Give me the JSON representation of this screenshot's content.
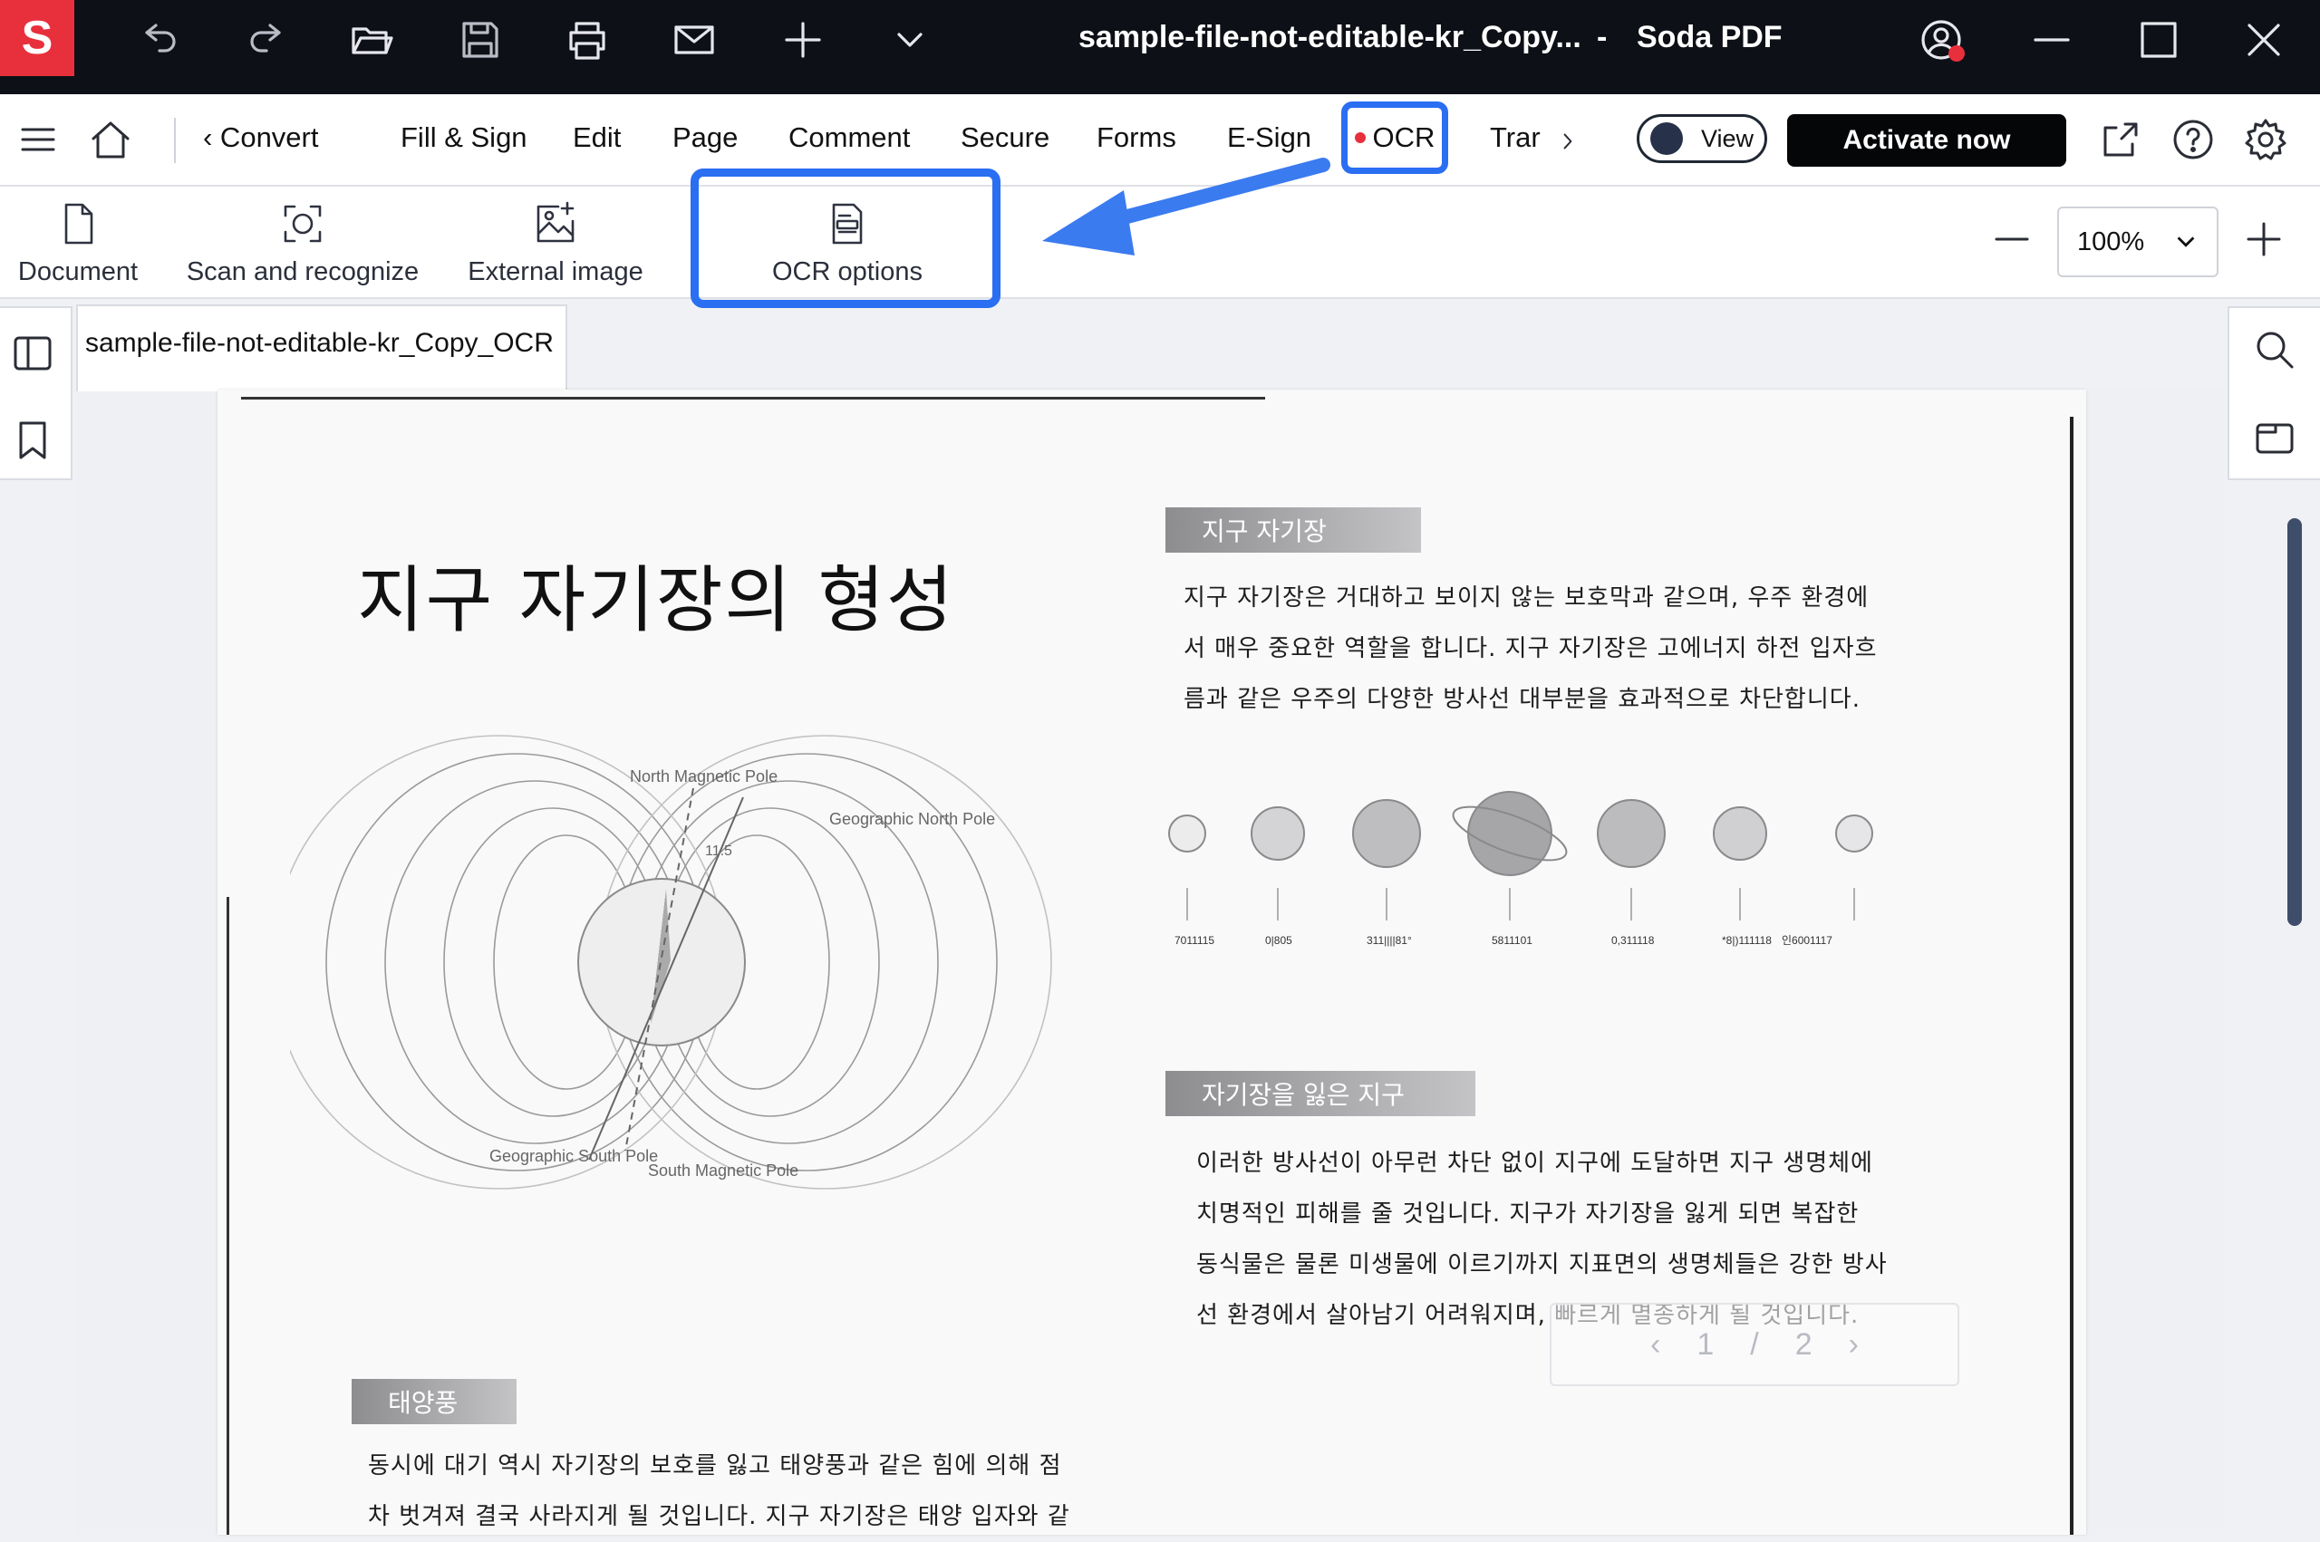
{
  "app": {
    "logo_letter": "S",
    "document_title": "sample-file-not-editable-kr_Copy...",
    "title_separator": "-",
    "app_name": "Soda PDF"
  },
  "titlebar_icons": [
    "undo-icon",
    "redo-icon",
    "open-folder-icon",
    "save-icon",
    "print-icon",
    "mail-icon",
    "plus-icon",
    "chevron-down-icon"
  ],
  "menu": {
    "tabs": [
      "‹ Convert",
      "Fill & Sign",
      "Edit",
      "Page",
      "Comment",
      "Secure",
      "Forms",
      "E-Sign",
      "OCR",
      "Trar"
    ],
    "active_tab": "OCR",
    "view_label": "View",
    "activate_label": "Activate now"
  },
  "ribbon": {
    "items": [
      "Document",
      "Scan and recognize",
      "External image",
      "OCR options"
    ],
    "zoom": "100%"
  },
  "doc_tab": {
    "label": "sample-file-not-editable-kr_Copy_OCR"
  },
  "page": {
    "heading": "지구 자기장의 형성",
    "section1": {
      "label": "지구 자기장",
      "lines": [
        "지구 자기장은 거대하고 보이지 않는 보호막과 같으며, 우주 환경에",
        "서 매우 중요한 역할을 합니다. 지구 자기장은 고에너지 하전 입자흐",
        "름과 같은 우주의 다양한 방사선 대부분을 효과적으로 차단합니다."
      ]
    },
    "planet_labels": [
      "7011115",
      "0|805",
      "311||||81°",
      "5811101",
      "0,311118",
      "*8|)111118",
      "인6001117"
    ],
    "section2": {
      "label": "자기장을 잃은 지구",
      "lines": [
        "이러한 방사선이 아무런 차단 없이 지구에 도달하면 지구 생명체에",
        "치명적인 피해를 줄 것입니다. 지구가 자기장을 잃게 되면 복잡한",
        "동식물은 물론 미생물에 이르기까지 지표면의 생명체들은 강한 방사",
        "선 환경에서 살아남기 어려워지며, 빠르게 멸종하게 될 것입니다."
      ]
    },
    "section3": {
      "label": "태양풍",
      "lines": [
        "동시에 대기 역시 자기장의 보호를 잃고 태양풍과 같은 힘에 의해 점",
        "차 벗겨져 결국 사라지게 될 것입니다. 지구 자기장은 태양 입자와 같"
      ]
    },
    "diagram_labels": {
      "north_magnetic": "North Magnetic Pole",
      "geo_north": "Geographic North Pole",
      "geo_south": "Geographic South Pole",
      "south_magnetic": "South Magnetic Pole",
      "angle": "11.5"
    },
    "page_nav": {
      "prev": "‹",
      "current": "1",
      "sep": "/",
      "total": "2",
      "next": "›"
    }
  },
  "colors": {
    "accent": "#2a6ef2",
    "brand": "#e8303c",
    "titlebar": "#0e1017"
  }
}
